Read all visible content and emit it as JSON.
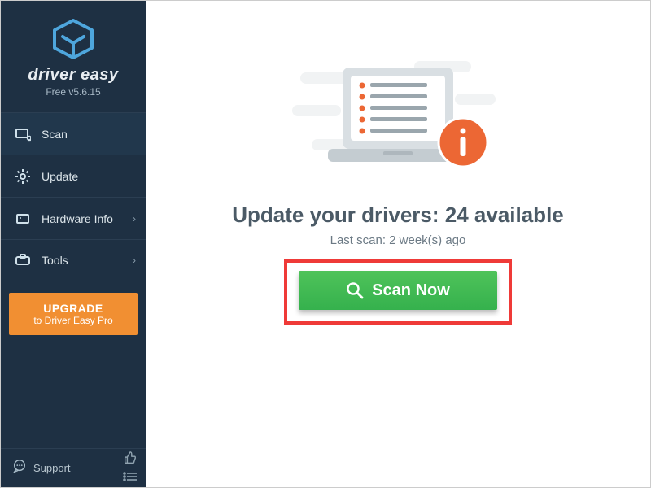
{
  "brand": {
    "name": "driver easy",
    "version": "Free v5.6.15"
  },
  "sidebar": {
    "items": [
      {
        "label": "Scan"
      },
      {
        "label": "Update"
      },
      {
        "label": "Hardware Info"
      },
      {
        "label": "Tools"
      }
    ],
    "upgrade": {
      "line1": "UPGRADE",
      "line2": "to Driver Easy Pro"
    },
    "support_label": "Support"
  },
  "main": {
    "headline_prefix": "Update your drivers: ",
    "available_count": 24,
    "headline_suffix": " available",
    "last_scan": "Last scan: 2 week(s) ago",
    "scan_button": "Scan Now"
  },
  "colors": {
    "sidebar_bg": "#1e3043",
    "accent_orange": "#f18f32",
    "scan_green": "#3fbb52",
    "annotation_red": "#ef3a38"
  }
}
